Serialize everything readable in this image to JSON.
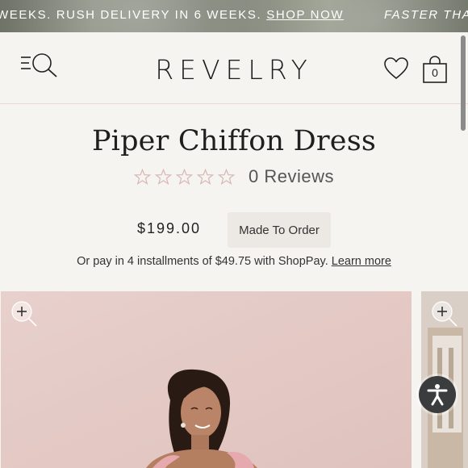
{
  "promo": {
    "text": "WEEKS. RUSH DELIVERY IN 6 WEEKS.",
    "link": "SHOP NOW",
    "text2": "FASTER THAN"
  },
  "header": {
    "logo": "REVELRY",
    "menu_icon": "menu-search-icon",
    "wishlist_icon": "heart-icon",
    "bag_icon": "shopping-bag-icon",
    "bag_count": "0"
  },
  "product": {
    "title": "Piper Chiffon Dress",
    "rating": {
      "value": 0,
      "max": 5,
      "reviews_label": "0 Reviews"
    },
    "price": "$199.00",
    "badge": "Made To Order",
    "installments_text": "Or pay in 4 installments of $49.75 with ShopPay.",
    "learn_more": "Learn more"
  },
  "gallery": {
    "zoom_icon": "zoom-in-icon",
    "accessibility_icon": "accessibility-icon"
  },
  "colors": {
    "background": "#f6f4f1",
    "star_outline": "#d9b9b4",
    "divider": "#e8d9d3",
    "image_bg": "#e6cdc9"
  }
}
